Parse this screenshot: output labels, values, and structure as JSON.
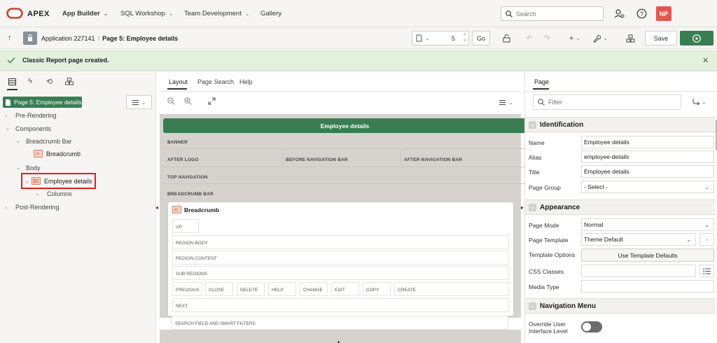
{
  "topnav": {
    "brand": "APEX",
    "items": [
      "App Builder",
      "SQL Workshop",
      "Team Development",
      "Gallery"
    ],
    "search_placeholder": "Search",
    "avatar_initials": "NP"
  },
  "toolbar": {
    "app_label": "Application 227141",
    "separator": "\\",
    "page_label": "Page 5: Employee details",
    "page_number": "5",
    "go_label": "Go",
    "save_label": "Save",
    "add_symbol": "+"
  },
  "banner": {
    "message": "Classic Report page created."
  },
  "left": {
    "page_badge": "Page 5: Employee details",
    "tree": {
      "pre_rendering": "Pre-Rendering",
      "components": "Components",
      "breadcrumb_bar": "Breadcrumb Bar",
      "breadcrumb": "Breadcrumb",
      "body": "Body",
      "employee_details": "Employee details",
      "columns": "Columns",
      "post_rendering": "Post-Rendering"
    }
  },
  "middle": {
    "tabs": [
      "Layout",
      "Page Search",
      "Help"
    ],
    "page_header": "Employee details",
    "rows": {
      "banner": "BANNER",
      "after_logo": "AFTER LOGO",
      "before_nav": "BEFORE NAVIGATION BAR",
      "after_nav": "AFTER NAVIGATION BAR",
      "top_nav": "TOP NAVIGATION",
      "breadcrumb_bar": "BREADCRUMB BAR"
    },
    "region_title": "Breadcrumb",
    "region_slots": {
      "up": "UP",
      "region_body": "REGION BODY",
      "region_content": "REGION CONTENT",
      "sub_regions": "SUB REGIONS",
      "buttons": [
        "PREVIOUS",
        "CLOSE",
        "DELETE",
        "HELP",
        "CHANGE",
        "EDIT",
        "COPY",
        "CREATE"
      ],
      "next": "NEXT",
      "search": "SEARCH FIELD AND SMART FILTERS"
    }
  },
  "right": {
    "tab": "Page",
    "filter_placeholder": "Filter",
    "sections": {
      "identification": "Identification",
      "appearance": "Appearance",
      "navigation": "Navigation Menu"
    },
    "props": {
      "name_label": "Name",
      "name_value": "Employee details",
      "alias_label": "Alias",
      "alias_value": "employee-details",
      "title_label": "Title",
      "title_value": "Employee details",
      "page_group_label": "Page Group",
      "page_group_value": "- Select -",
      "page_mode_label": "Page Mode",
      "page_mode_value": "Normal",
      "page_template_label": "Page Template",
      "page_template_value": "Theme Default",
      "template_options_label": "Template Options",
      "template_defaults_button": "Use Template Defaults",
      "css_classes_label": "CSS Classes",
      "media_type_label": "Media Type",
      "override_label_1": "Override User",
      "override_label_2": "Interface Level"
    }
  },
  "colors": {
    "brand_red": "#c74634",
    "accent_green": "#3a7d52",
    "banner_bg": "#e3f0de",
    "highlight_red": "#e02020"
  }
}
